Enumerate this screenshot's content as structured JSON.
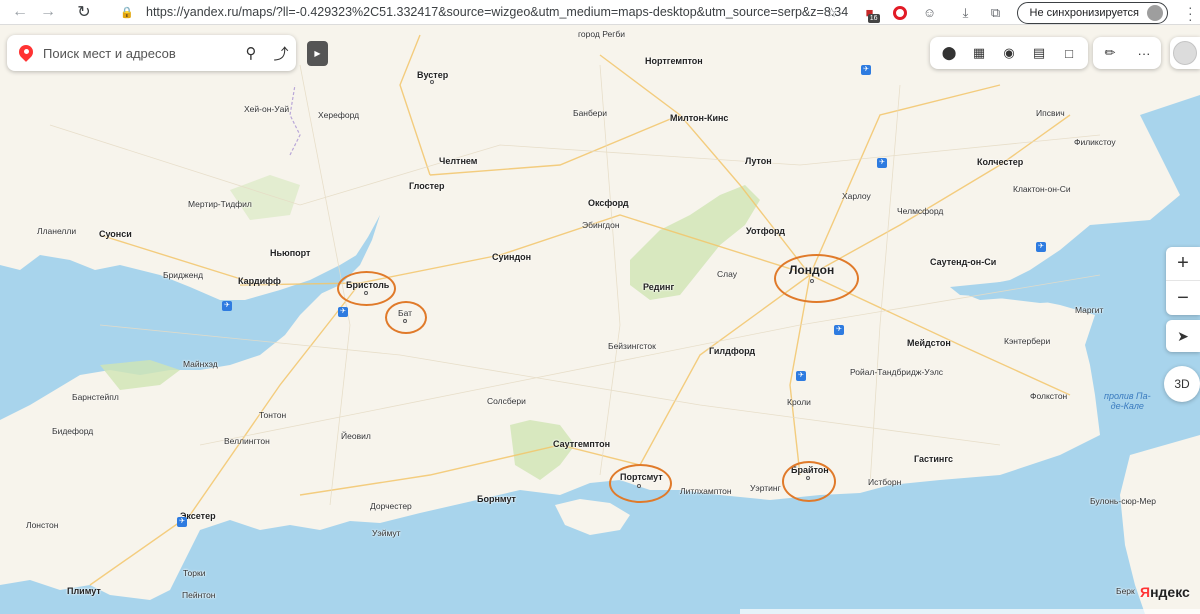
{
  "browser": {
    "url": "https://yandex.ru/maps/?ll=-0.429323%2C51.332417&source=wizgeo&utm_medium=maps-desktop&utm_source=serp&z=8.34",
    "badge_count": "16",
    "sync_label": "Не синхронизируется"
  },
  "search": {
    "placeholder": "Поиск мест и адресов"
  },
  "map_controls": {
    "btn_3d": "3D",
    "logo_prefix": "Я",
    "logo_rest": "ндекс"
  },
  "places": {
    "worcester": "Вустер",
    "hay": "Хей-он-Уай",
    "hereford": "Херефорд",
    "cheltenham": "Челтнем",
    "gloucester": "Глостер",
    "merthyr": "Мертир-Тидфил",
    "llanelli": "Лланелли",
    "swansea": "Суонси",
    "newport": "Ньюпорт",
    "bridgend": "Бридженд",
    "cardiff": "Кардифф",
    "bristol": "Бристоль",
    "bath": "Бат",
    "swindon": "Суиндон",
    "oxford": "Оксфорд",
    "abingdon": "Эбингдон",
    "banbury": "Банбери",
    "rugby": "город Регби",
    "northampton": "Нортгемптон",
    "milton_keynes": "Милтон-Кинс",
    "luton": "Лутон",
    "watford": "Уотфорд",
    "slough": "Слау",
    "reading": "Рединг",
    "london": "Лондон",
    "harlow": "Харлоу",
    "chelmsford": "Челмсфорд",
    "colchester": "Колчестер",
    "ipswich": "Ипсвич",
    "felixstowe": "Филикстоу",
    "clacton": "Клактон-он-Си",
    "southend": "Саутенд-он-Си",
    "margate": "Маргит",
    "maidstone": "Мейдстон",
    "canterbury": "Кэнтербери",
    "tunbridge": "Ройал-Тандбридж-Уэлс",
    "folkestone": "Фолкстон",
    "basingstoke": "Бейзингсток",
    "guildford": "Гилдфорд",
    "crawley": "Кроли",
    "brighton": "Брайтон",
    "hastings": "Гастингс",
    "eastbourne": "Истборн",
    "worthing": "Уэртинг",
    "littlehampton": "Литлхамптон",
    "portsmouth": "Портсмут",
    "southampton": "Саутгемптон",
    "salisbury": "Солсбери",
    "bournemouth": "Борнмут",
    "dorchester": "Дорчестер",
    "weymouth": "Уэймут",
    "yeovil": "Йеовил",
    "taunton": "Тонтон",
    "wellington": "Веллингтон",
    "minehead": "Майнхэд",
    "barnstaple": "Барнстейпл",
    "bideford": "Бидефорд",
    "exeter": "Эксетер",
    "launceston": "Лонстон",
    "plymouth": "Плимут",
    "torquay": "Торки",
    "paignton": "Пейнтон",
    "boulogne": "Булонь-сюр-Мер",
    "berck": "Берк",
    "strait": "пролив Па-де-Кале",
    "strait_l1": "пролив Па-",
    "strait_l2": "де-Кале"
  }
}
